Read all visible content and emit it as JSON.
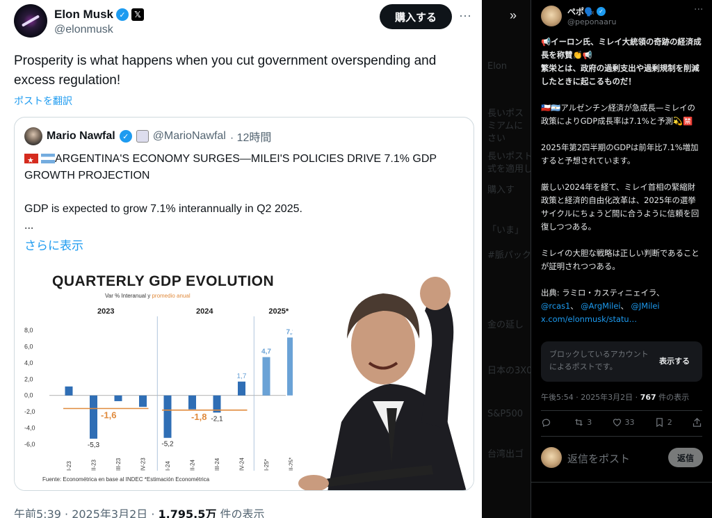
{
  "main_post": {
    "author_name": "Elon Musk",
    "verified_icon": "verified-badge-icon",
    "x_icon": "x-logo-icon",
    "handle": "@elonmusk",
    "buy_button": "購入する",
    "more_icon": "···",
    "text": "Prosperity is what happens when you cut government overspending and excess regulation!",
    "translate_link": "ポストを翻訳",
    "meta_time": "午前5:39 · 2025年3月2日 · ",
    "meta_views": "1,795.5万",
    "meta_views_suffix": " 件の表示"
  },
  "quoted_post": {
    "author_name": "Mario Nawfal",
    "handle": "@MarioNawfal",
    "time": "· 12時間",
    "headline": "ARGENTINA'S ECONOMY SURGES—MILEI'S POLICIES DRIVE 7.1% GDP GROWTH PROJECTION",
    "body": "GDP is expected to grow 7.1% interannually in Q2 2025.\n...",
    "show_more": "さらに表示"
  },
  "chart_data": {
    "type": "bar",
    "title": "QUARTERLY GDP EVOLUTION",
    "subtitle_prefix": "Var % Interanual y ",
    "subtitle_highlight": "promedio anual",
    "groups": [
      "2023",
      "2024",
      "2025*"
    ],
    "categories": [
      "I-23",
      "II-23",
      "III-23",
      "IV-23",
      "I-24",
      "II-24",
      "III-24",
      "IV-24",
      "I-25*",
      "II-25*"
    ],
    "values": [
      1.1,
      -5.3,
      -0.7,
      -1.4,
      -5.2,
      -1.7,
      -2.1,
      1.7,
      4.7,
      7.1
    ],
    "value_labels": [
      "",
      "-5,3",
      "",
      "",
      "-5,2",
      "",
      "-2,1",
      "1,7",
      "4,7",
      "7,1"
    ],
    "annual_averages": [
      {
        "group": "2023",
        "value": -1.6,
        "label": "-1,6"
      },
      {
        "group": "2024",
        "value": -1.8,
        "label": "-1,8"
      }
    ],
    "yticks": [
      "8,0",
      "6,0",
      "4,0",
      "2,0",
      "0,0",
      "-2,0",
      "-4,0",
      "-6,0"
    ],
    "ylim": [
      -6.5,
      8.5
    ],
    "colors": {
      "bar": "#2f6eb5",
      "projected": "#6aa2d6",
      "average": "#e08a3c",
      "negative_label": "#2f6eb5"
    },
    "footnote": "Fuente: Econométrica en base al INDEC        *Estimación Econométrica"
  },
  "strip": {
    "collapse_icon": "»",
    "ghost_lines": [
      "Elon",
      "長いポス",
      "ミアムに",
      "さい",
      "長いポスト",
      "式を適用し",
      "購入す",
      "「いま」",
      "#脈パックの",
      "金の延し",
      "日本の3X0",
      "S&P500",
      "台湾出ゴ"
    ]
  },
  "side_post": {
    "author_name": "ぺポ🗣️",
    "handle": "@peponaaru",
    "more_icon": "···",
    "headline": "📢イーロン氏、ミレイ大統領の奇跡の経済成長を称賛👏📢\n繁栄とは、政府の過剰支出や過剰規制を削減したときに起こるものだ！",
    "para1": "🇨🇱🇦🇷アルゼンチン経済が急成長—ミレイの政策によりGDP成長率は7.1%と予測💫🈲",
    "para2": "2025年第2四半期のGDPは前年比7.1%増加すると予想されています。",
    "para3": "厳しい2024年を経て、ミレイ首相の緊縮財政策と経済的自由化改革は、2025年の選挙サイクルにちょうど間に合うように信頼を回復しつつある。",
    "para4": "ミレイの大胆な戦略は正しい判断であることが証明されつつある。",
    "source_prefix": "出典: ラミロ・カスティニェイラ、",
    "mention1": "@rcas1",
    "mention2": "@ArgMilei",
    "mention3": "@JMilei",
    "link": "x.com/elonmusk/statu…",
    "blocked_text": "ブロックしているアカウントによるポストです。",
    "blocked_button": "表示する",
    "meta_time": "午後5:54 · 2025年3月2日 · ",
    "meta_views": "767",
    "meta_views_suffix": " 件の表示",
    "replies": "",
    "reposts": "3",
    "likes": "33",
    "bookmarks": "2",
    "reply_placeholder": "返信をポスト",
    "reply_button": "返信"
  }
}
